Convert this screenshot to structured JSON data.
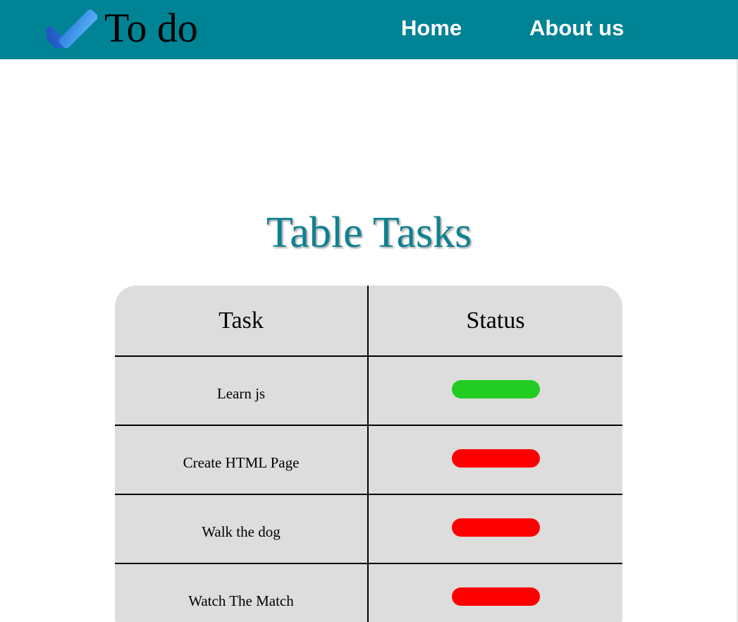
{
  "header": {
    "brand": "To do",
    "brand_icon": "checkmark-icon",
    "nav": [
      {
        "label": "Home"
      },
      {
        "label": "About us"
      }
    ],
    "background_color": "#008394"
  },
  "main": {
    "title": "Table Tasks",
    "title_color": "#0e8190"
  },
  "table": {
    "columns": [
      "Task",
      "Status"
    ],
    "rows": [
      {
        "task": "Learn js",
        "status_color": "#22cc22",
        "status": "done"
      },
      {
        "task": "Create HTML Page",
        "status_color": "#ff0000",
        "status": "not done"
      },
      {
        "task": "Walk the dog",
        "status_color": "#ff0000",
        "status": "not done"
      },
      {
        "task": "Watch The Match",
        "status_color": "#ff0000",
        "status": "not done"
      }
    ],
    "background_color": "#dddddd"
  }
}
